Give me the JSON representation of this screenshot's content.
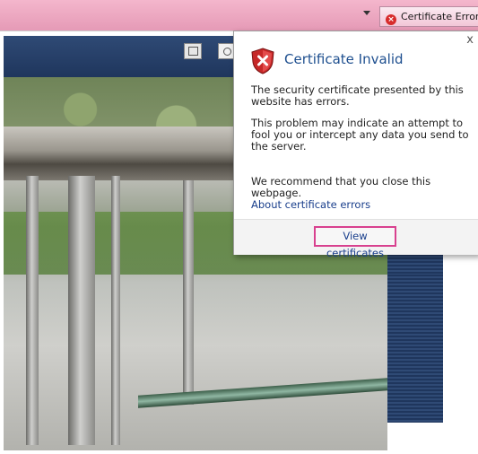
{
  "addressbar": {
    "cert_error_label": "Certificate Error",
    "cert_error_icon": "error-x-icon"
  },
  "popup": {
    "title": "Certificate Invalid",
    "close_label": "x",
    "text1": "The security certificate presented by this website has errors.",
    "text2": "This problem may indicate an attempt to fool you or intercept any data you send to the server.",
    "text3": "We recommend that you close this webpage.",
    "about_link": "About certificate errors",
    "view_certificates": "View certificates",
    "shield_icon": "shield-error-icon"
  },
  "colors": {
    "addressbar_pink": "#e9a3bd",
    "navbar_blue": "#1f365d",
    "title_blue": "#1e4f8f",
    "highlight_magenta": "#d8418f"
  }
}
